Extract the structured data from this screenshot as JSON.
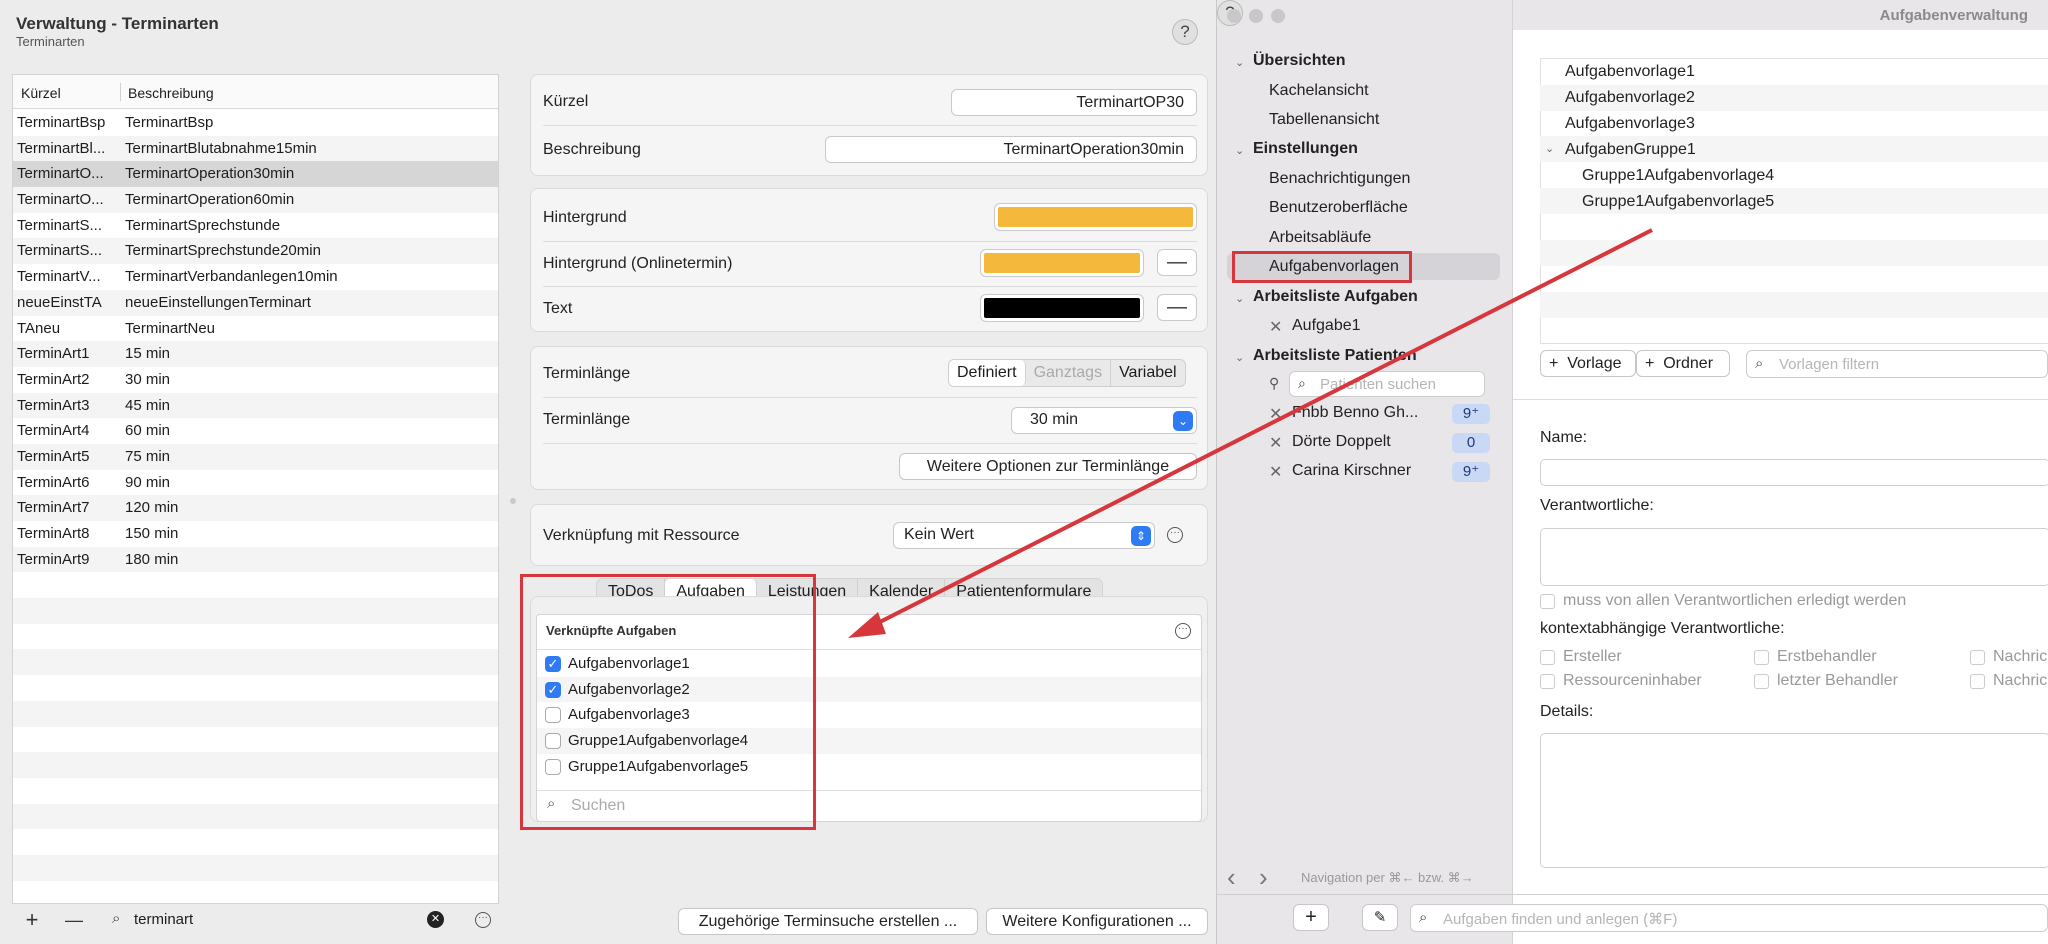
{
  "left_window": {
    "title": "Verwaltung - Terminarten",
    "subtitle": "Terminarten",
    "help": "?",
    "list": {
      "headers": [
        "Kürzel",
        "Beschreibung"
      ],
      "rows": [
        {
          "k": "TerminartBsp",
          "d": "TerminartBsp"
        },
        {
          "k": "TerminartBl...",
          "d": "TerminartBlutabnahme15min"
        },
        {
          "k": "TerminartO...",
          "d": "TerminartOperation30min",
          "selected": true
        },
        {
          "k": "TerminartO...",
          "d": "TerminartOperation60min"
        },
        {
          "k": "TerminartS...",
          "d": "TerminartSprechstunde"
        },
        {
          "k": "TerminartS...",
          "d": "TerminartSprechstunde20min"
        },
        {
          "k": "TerminartV...",
          "d": "TerminartVerbandanlegen10min"
        },
        {
          "k": "neueEinstTA",
          "d": "neueEinstellungenTerminart"
        },
        {
          "k": "TAneu",
          "d": "TerminartNeu"
        },
        {
          "k": "TerminArt1",
          "d": "15 min"
        },
        {
          "k": "TerminArt2",
          "d": "30 min"
        },
        {
          "k": "TerminArt3",
          "d": "45 min"
        },
        {
          "k": "TerminArt4",
          "d": "60 min"
        },
        {
          "k": "TerminArt5",
          "d": "75 min"
        },
        {
          "k": "TerminArt6",
          "d": "90 min"
        },
        {
          "k": "TerminArt7",
          "d": "120 min"
        },
        {
          "k": "TerminArt8",
          "d": "150 min"
        },
        {
          "k": "TerminArt9",
          "d": "180 min"
        },
        {
          "k": "",
          "d": ""
        },
        {
          "k": "",
          "d": ""
        },
        {
          "k": "",
          "d": ""
        },
        {
          "k": "",
          "d": ""
        },
        {
          "k": "",
          "d": ""
        },
        {
          "k": "",
          "d": ""
        },
        {
          "k": "",
          "d": ""
        },
        {
          "k": "",
          "d": ""
        },
        {
          "k": "",
          "d": ""
        },
        {
          "k": "",
          "d": ""
        },
        {
          "k": "",
          "d": ""
        },
        {
          "k": "",
          "d": ""
        }
      ],
      "add": "+",
      "remove": "—",
      "search_value": "terminart"
    },
    "detail": {
      "kuerzel_label": "Kürzel",
      "kuerzel_value": "TerminartOP30",
      "beschreibung_label": "Beschreibung",
      "beschreibung_value": "TerminartOperation30min",
      "hintergrund_label": "Hintergrund",
      "hintergrund_online_label": "Hintergrund (Onlinetermin)",
      "text_label": "Text",
      "color_bg": "#f4b93c",
      "color_bg_online": "#f4b93c",
      "color_text": "#000000",
      "remove": "—",
      "terminlaenge_label": "Terminlänge",
      "seg": [
        "Definiert",
        "Ganztags",
        "Variabel"
      ],
      "terminlaenge2_label": "Terminlänge",
      "terminlaenge_value": "30 min",
      "weitere_optionen": "Weitere Optionen zur Terminlänge",
      "ressource_label": "Verknüpfung mit Ressource",
      "ressource_value": "Kein Wert",
      "tabs": [
        "ToDos",
        "Aufgaben",
        "Leistungen",
        "Kalender",
        "Patientenformulare"
      ],
      "linked_header": "Verknüpfte Aufgaben",
      "tasks": [
        {
          "label": "Aufgabenvorlage1",
          "checked": true
        },
        {
          "label": "Aufgabenvorlage2",
          "checked": true
        },
        {
          "label": "Aufgabenvorlage3",
          "checked": false
        },
        {
          "label": "Gruppe1Aufgabenvorlage4",
          "checked": false
        },
        {
          "label": "Gruppe1Aufgabenvorlage5",
          "checked": false
        }
      ],
      "search_placeholder": "Suchen",
      "btn_terminsuche": "Zugehörige Terminsuche erstellen ...",
      "btn_weitere_konfig": "Weitere Konfigurationen ..."
    }
  },
  "right_window": {
    "title": "Aufgabenverwaltung",
    "nav": {
      "uebersichten": "Übersichten",
      "kachelansicht": "Kachelansicht",
      "tabellenansicht": "Tabellenansicht",
      "einstellungen": "Einstellungen",
      "benachrichtigungen": "Benachrichtigungen",
      "benutzeroberflaeche": "Benutzeroberfläche",
      "arbeitsablaeufe": "Arbeitsabläufe",
      "aufgabenvorlagen": "Aufgabenvorlagen",
      "arbeitsliste_aufgaben": "Arbeitsliste Aufgaben",
      "aufgabe1": "Aufgabe1",
      "arbeitsliste_patienten": "Arbeitsliste Patienten",
      "patient_search_placeholder": "Patienten suchen",
      "patients": [
        {
          "name": "Fhbb Benno Gh...",
          "badge": "9⁺"
        },
        {
          "name": "Dörte Doppelt",
          "badge": "0"
        },
        {
          "name": "Carina Kirschner",
          "badge": "9⁺"
        }
      ],
      "nav_hint": "Navigation per ⌘← bzw. ⌘→"
    },
    "templates": [
      "Aufgabenvorlage1",
      "Aufgabenvorlage2",
      "Aufgabenvorlage3",
      "AufgabenGruppe1",
      "Gruppe1Aufgabenvorlage4",
      "Gruppe1Aufgabenvorlage5"
    ],
    "btn_vorlage": "Vorlage",
    "btn_ordner": "Ordner",
    "filter_placeholder": "Vorlagen filtern",
    "form": {
      "name_label": "Name:",
      "verantwortliche_label": "Verantwortliche:",
      "muss_label": "muss von allen Verantwortlichen erledigt werden",
      "kontext_label": "kontextabhängige Verantwortliche:",
      "ersteller": "Ersteller",
      "erstbehandler": "Erstbehandler",
      "nachric1": "Nachric",
      "ressourceninhaber": "Ressourceninhaber",
      "letzter": "letzter Behandler",
      "nachric2": "Nachric",
      "details_label": "Details:"
    },
    "bottom_search_placeholder": "Aufgaben finden und anlegen (⌘F)"
  },
  "annotation_color": "#d6363c"
}
